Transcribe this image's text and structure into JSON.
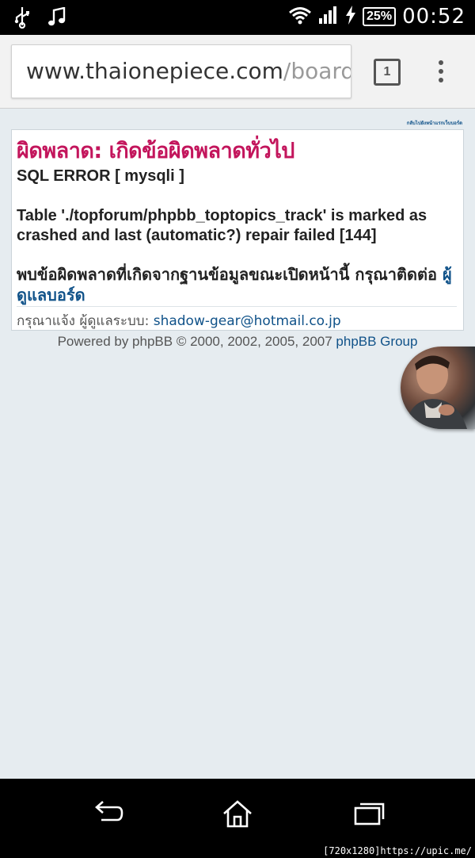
{
  "status_bar": {
    "battery_percent": "25%",
    "time": "00:52",
    "icons": [
      "usb-icon",
      "music-note-icon",
      "wifi-icon",
      "signal-icon",
      "charging-icon",
      "battery-icon"
    ]
  },
  "browser": {
    "url_domain": "www.thaionepiece.com",
    "url_path": "/board/v",
    "tab_count": "1"
  },
  "page": {
    "back_link": "กลับไปยังหน้าแรกเว็บบอร์ด",
    "error_title": "ผิดพลาด: เกิดข้อผิดพลาดทั่วไป",
    "sql_error_title": "SQL ERROR [ mysqli ]",
    "sql_error_message": "Table './topforum/phpbb_toptopics_track' is marked as crashed and last (automatic?) repair failed [144]",
    "thai_message": "พบข้อผิดพลาดที่เกิดจากฐานข้อมูลขณะเปิดหน้านี้ กรุณาติดต่อ ",
    "admin_link": "ผู้ดูแลบอร์ด",
    "contact_label": "กรุณาแจ้ง ผู้ดูแลระบบ: ",
    "contact_email": "shadow-gear@hotmail.co.jp",
    "powered_prefix": "Powered by phpBB © 2000, 2002, 2005, 2007 ",
    "powered_link": "phpBB Group"
  },
  "watermark": "[720x1280]https://upic.me/",
  "colors": {
    "error_title": "#c3155c",
    "link": "#105289",
    "background": "#e6ecf0"
  }
}
